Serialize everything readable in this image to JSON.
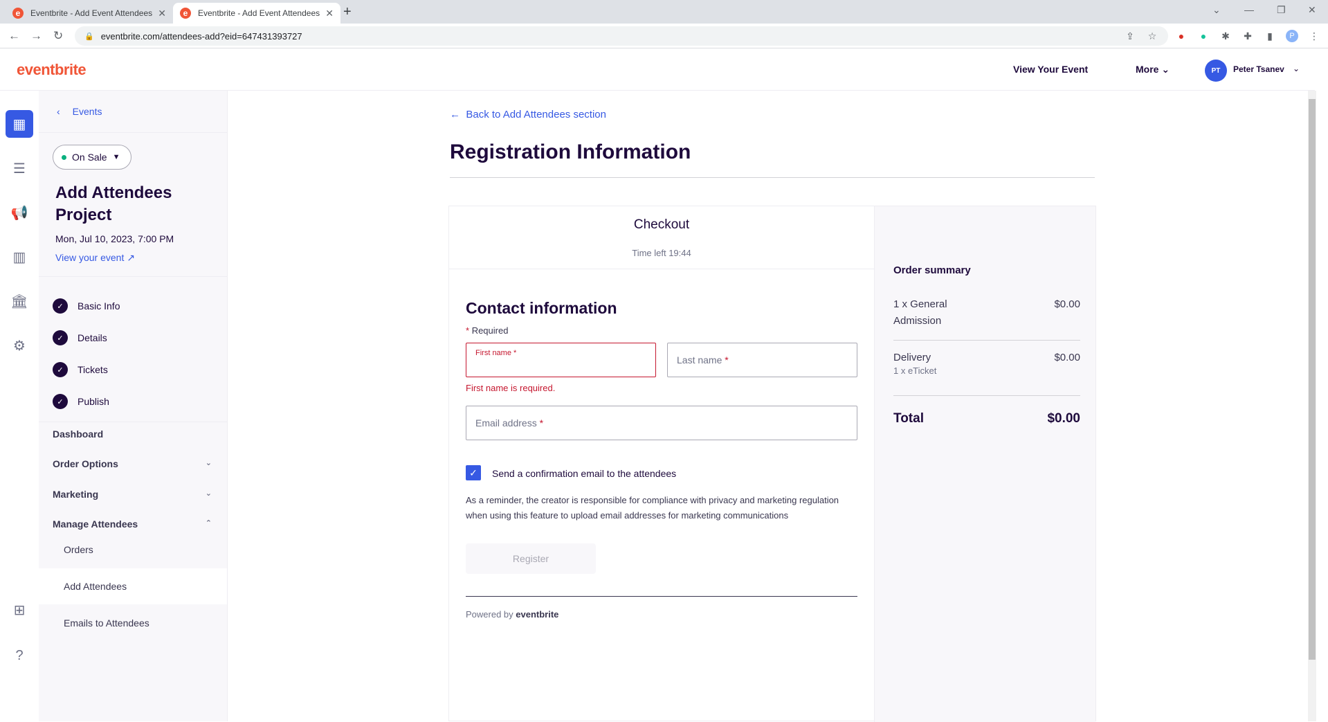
{
  "browser": {
    "tabs": [
      {
        "title": "Eventbrite - Add Event Attendees",
        "favicon": "e"
      },
      {
        "title": "Eventbrite - Add Event Attendees",
        "favicon": "e"
      }
    ],
    "url": "eventbrite.com/attendees-add?eid=647431393727",
    "profile_initial": "P"
  },
  "header": {
    "logo": "eventbrite",
    "view_event": "View Your Event",
    "more": "More",
    "user_initials": "PT",
    "user_name": "Peter Tsanev"
  },
  "sidebar": {
    "back_label": "Events",
    "status": "On Sale",
    "event_title": "Add Attendees Project",
    "event_date": "Mon, Jul 10, 2023, 7:00 PM",
    "view_event": "View your event",
    "steps": [
      "Basic Info",
      "Details",
      "Tickets",
      "Publish"
    ],
    "nav": [
      "Dashboard",
      "Order Options",
      "Marketing",
      "Manage Attendees"
    ],
    "sub_items": [
      "Orders",
      "Add Attendees",
      "Emails to Attendees"
    ]
  },
  "main": {
    "back_link": "Back to Add Attendees section",
    "title": "Registration Information",
    "checkout": {
      "heading": "Checkout",
      "time_left": "Time left 19:44",
      "contact_title": "Contact information",
      "required": "Required",
      "first_name_label": "First name",
      "last_name_label": "Last name",
      "email_label": "Email address",
      "first_name_error": "First name is required.",
      "confirmation_label": "Send a confirmation email to the attendees",
      "reminder": "As a reminder, the creator is responsible for compliance with privacy and marketing regulation when using this feature to upload email addresses for marketing communications",
      "register": "Register",
      "powered_by": "Powered by",
      "powered_brand": "eventbrite"
    },
    "order_summary": {
      "title": "Order summary",
      "ticket_line": "1 x General Admission",
      "ticket_amount": "$0.00",
      "delivery": "Delivery",
      "delivery_sub": "1 x eTicket",
      "delivery_amount": "$0.00",
      "total_label": "Total",
      "total_amount": "$0.00"
    }
  }
}
